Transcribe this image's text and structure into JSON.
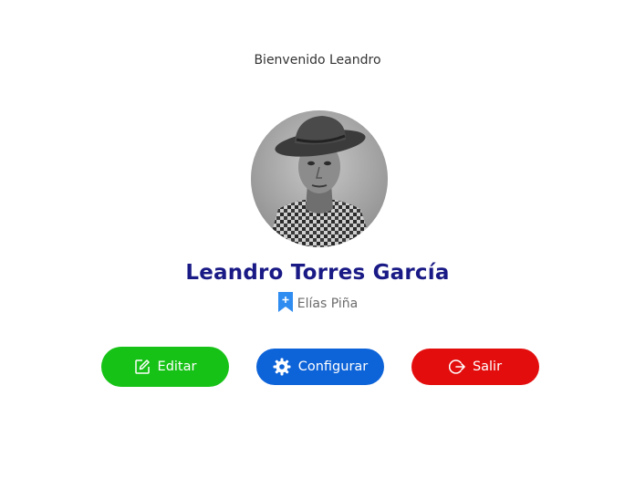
{
  "welcome_text": "Bienvenido Leandro",
  "profile": {
    "name": "Leandro Torres García",
    "location": "Elías Piña",
    "location_icon": "bookmark-plus-icon",
    "avatar_icon": "profile-photo"
  },
  "actions": {
    "edit_label": "Editar",
    "edit_icon": "edit-icon",
    "config_label": "Configurar",
    "config_icon": "gear-icon",
    "exit_label": "Salir",
    "exit_icon": "logout-icon"
  },
  "colors": {
    "name": "#1a1a86",
    "edit": "#17c217",
    "config": "#0d63d8",
    "exit": "#e30d0d",
    "location_icon": "#2f8cf0"
  }
}
